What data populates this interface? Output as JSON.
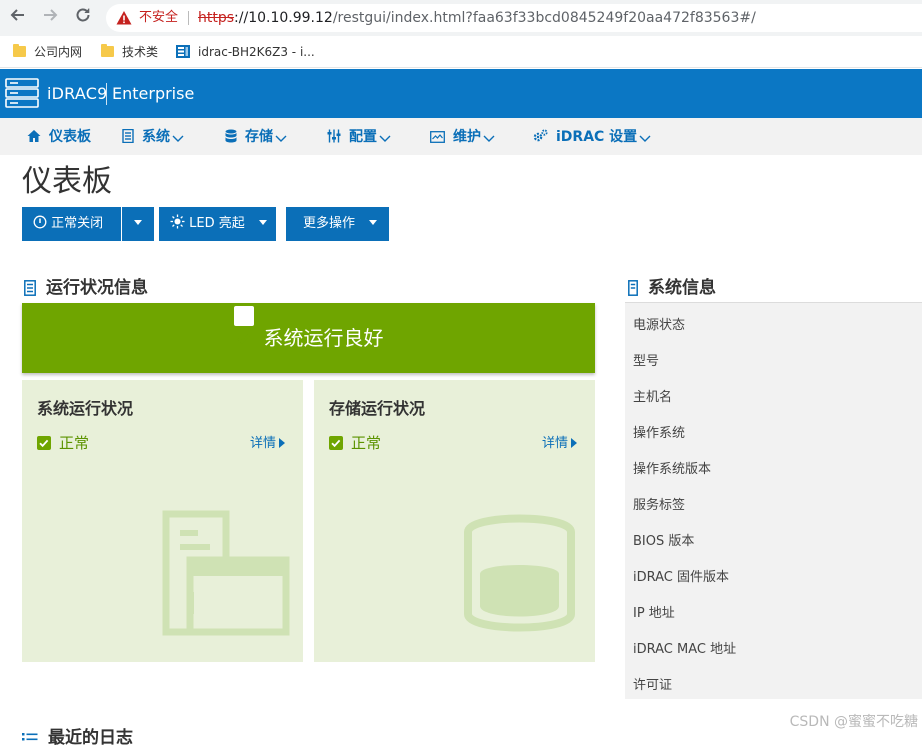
{
  "browser": {
    "security_label": "不安全",
    "url_scheme": "https",
    "url_host": "://10.10.99.12",
    "url_rest": "/restgui/index.html?faa63f33bcd0845249f20aa472f83563#/",
    "bookmarks": [
      "公司内网",
      "技术类",
      "idrac-BH2K6Z3 - i..."
    ]
  },
  "header": {
    "product": "iDRAC9",
    "edition": "Enterprise",
    "brand_color": "#0b77c4"
  },
  "menu": {
    "items": [
      {
        "label": "仪表板",
        "icon": "home-icon"
      },
      {
        "label": "系统",
        "icon": "server-icon"
      },
      {
        "label": "存储",
        "icon": "database-icon"
      },
      {
        "label": "配置",
        "icon": "sliders-icon"
      },
      {
        "label": "维护",
        "icon": "monitor-icon"
      },
      {
        "label": "iDRAC 设置",
        "icon": "gears-icon"
      }
    ]
  },
  "page": {
    "title": "仪表板"
  },
  "actions": {
    "shutdown_label": "正常关闭",
    "led_label": "LED 亮起",
    "more_label": "更多操作"
  },
  "health": {
    "section_title": "运行状况信息",
    "banner_text": "系统运行良好",
    "banner_color": "#6fa500",
    "cards": [
      {
        "title": "系统运行状况",
        "status": "正常",
        "details": "详情"
      },
      {
        "title": "存储运行状况",
        "status": "正常",
        "details": "详情"
      }
    ]
  },
  "system_info": {
    "section_title": "系统信息",
    "rows": [
      "电源状态",
      "型号",
      "主机名",
      "操作系统",
      "操作系统版本",
      "服务标签",
      "BIOS 版本",
      "iDRAC 固件版本",
      "IP 地址",
      "iDRAC MAC 地址",
      "许可证"
    ]
  },
  "logs": {
    "section_title": "最近的日志"
  },
  "watermark": "CSDN @蜜蜜不吃糖"
}
